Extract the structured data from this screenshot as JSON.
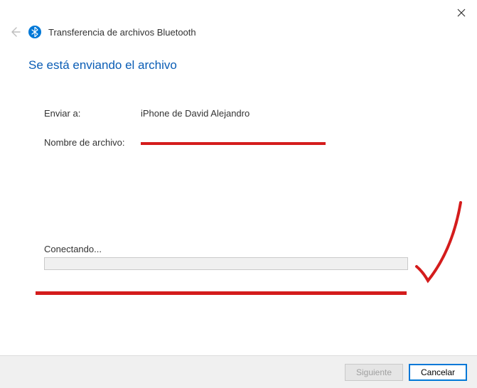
{
  "header": {
    "window_title": "Transferencia de archivos Bluetooth",
    "main_heading": "Se está enviando el archivo"
  },
  "fields": {
    "send_to_label": "Enviar a:",
    "send_to_value": "iPhone de David Alejandro",
    "filename_label": "Nombre de archivo:",
    "filename_value": ""
  },
  "status": {
    "label": "Conectando..."
  },
  "footer": {
    "next_label": "Siguiente",
    "cancel_label": "Cancelar"
  }
}
